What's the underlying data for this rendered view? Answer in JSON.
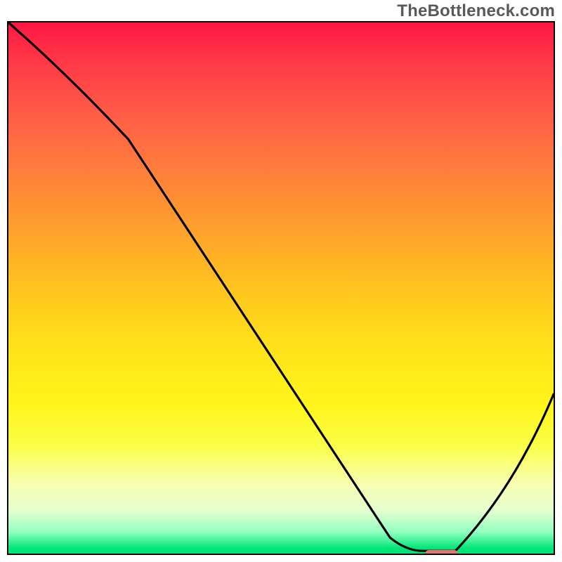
{
  "watermark": "TheBottleneck.com",
  "colors": {
    "top": "#ff1744",
    "mid": "#ffe419",
    "bottom": "#00e676",
    "curve": "#000000",
    "marker": "#e57373",
    "border": "#000000"
  },
  "chart_data": {
    "type": "line",
    "title": "",
    "xlabel": "",
    "ylabel": "",
    "xlim": [
      0,
      100
    ],
    "ylim": [
      0,
      100
    ],
    "series": [
      {
        "name": "bottleneck-curve",
        "x": [
          0,
          22,
          70,
          76,
          82,
          100
        ],
        "values": [
          100,
          78,
          3,
          0.5,
          0.5,
          30
        ]
      }
    ],
    "annotations": [
      {
        "name": "optimal-range-marker",
        "x_start": 76,
        "x_end": 82,
        "y": 0.5,
        "color": "#e57373"
      }
    ],
    "notes": "Background is a vertical heat gradient from red (top, high bottleneck) through orange/yellow to green (bottom, optimal). The black curve descends steeply from top-left, reaches a minimum near x≈76–82 (marked by the red rounded bar), then rises toward the right edge. No axes, ticks, or numeric labels are rendered."
  }
}
